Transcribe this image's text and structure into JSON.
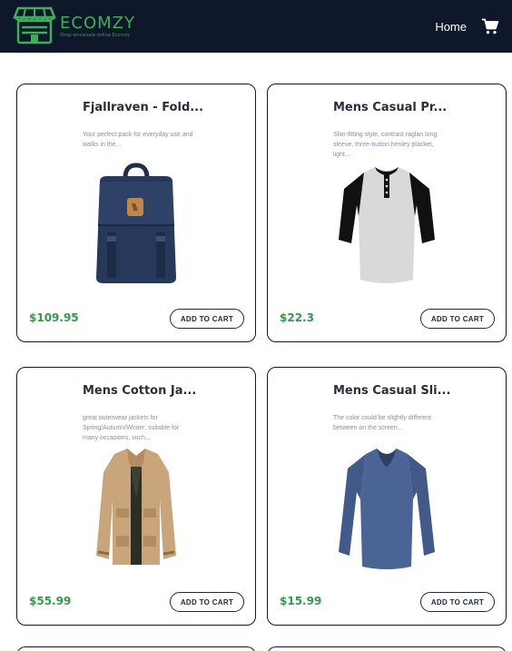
{
  "brand": {
    "name": "ECOMZY",
    "tagline": "Shop wholesale online Ecomzy",
    "color": "#3fae5a"
  },
  "nav": {
    "home_label": "Home",
    "cart_icon": "cart-icon"
  },
  "products": [
    {
      "title": "Fjallraven - Fold...",
      "description": "Your perfect pack for everyday use and walks in the...",
      "price": "$109.95",
      "button_label": "ADD TO CART",
      "image": "navy-backpack"
    },
    {
      "title": "Mens Casual Pr...",
      "description": "Slim-fitting style, contrast raglan long sleeve, three-button henley placket, light...",
      "price": "$22.3",
      "button_label": "ADD TO CART",
      "image": "raglan-henley-shirt"
    },
    {
      "title": "Mens Cotton Ja...",
      "description": "great outerwear jackets for Spring/Autumn/Winter, suitable for many occasions, such...",
      "price": "$55.99",
      "button_label": "ADD TO CART",
      "image": "khaki-cotton-jacket"
    },
    {
      "title": "Mens Casual Sli...",
      "description": "The color could be slightly different between on the screen...",
      "price": "$15.99",
      "button_label": "ADD TO CART",
      "image": "blue-slim-tshirt"
    }
  ],
  "colors": {
    "navbar_bg": "#0f172a",
    "price": "#2f9a4b",
    "card_border": "#111827"
  }
}
